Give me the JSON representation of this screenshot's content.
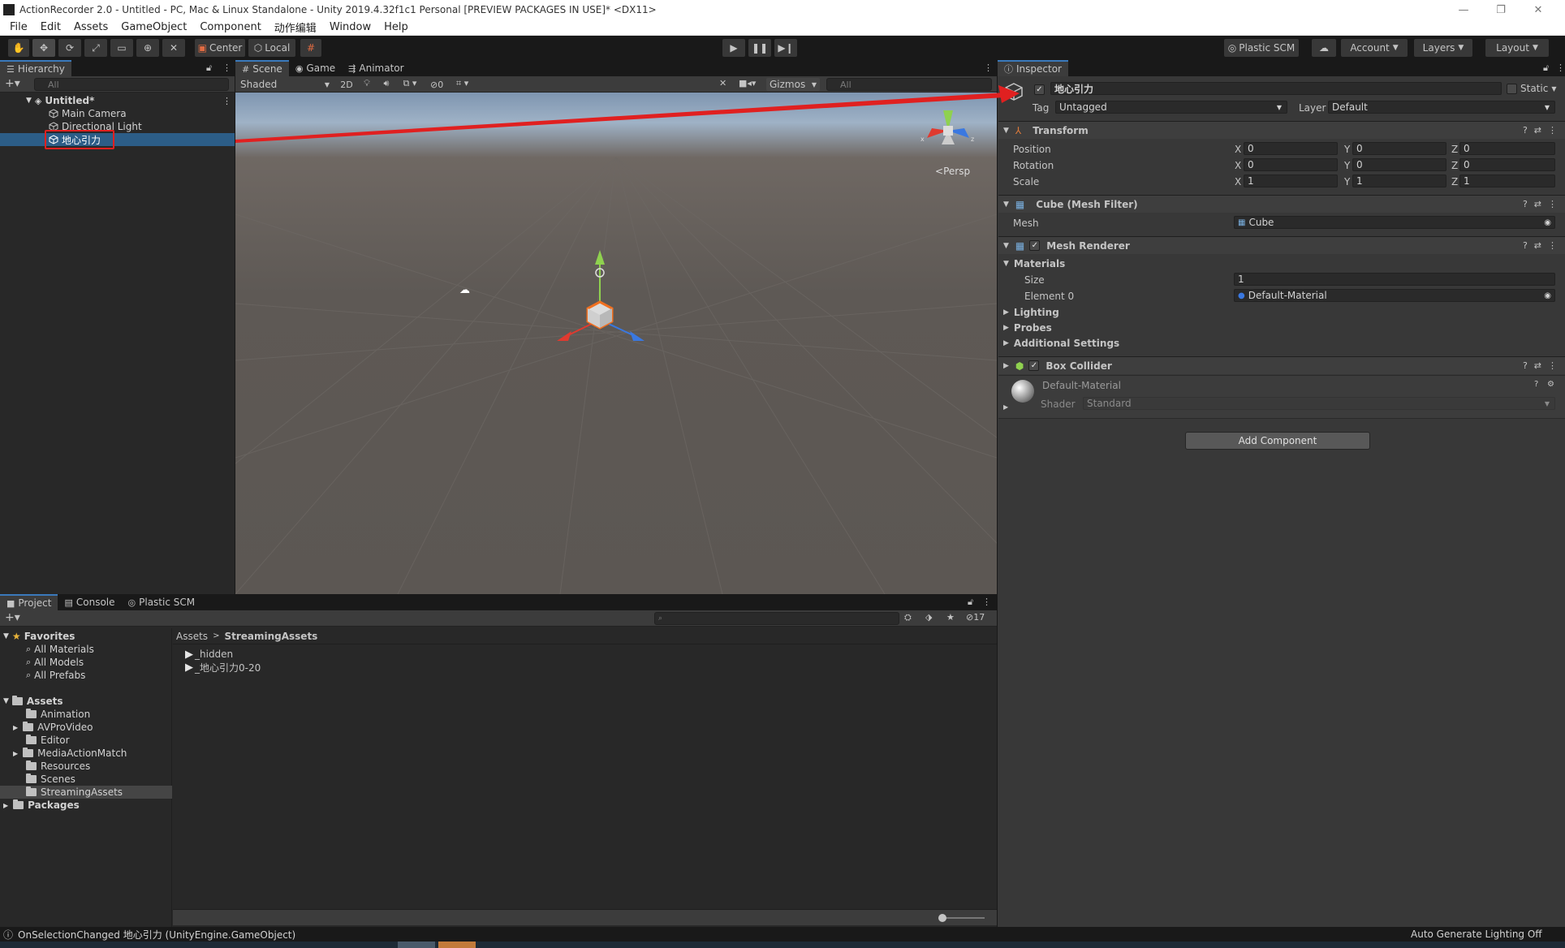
{
  "window": {
    "title": "ActionRecorder 2.0 - Untitled - PC, Mac & Linux Standalone - Unity 2019.4.32f1c1 Personal [PREVIEW PACKAGES IN USE]* <DX11>",
    "minimize": "—",
    "maximize": "❐",
    "close": "✕"
  },
  "menu": [
    "File",
    "Edit",
    "Assets",
    "GameObject",
    "Component",
    "动作编辑",
    "Window",
    "Help"
  ],
  "toolbar": {
    "pivot_label": "Center",
    "space_label": "Local",
    "plastic_label": "Plastic SCM",
    "account_label": "Account",
    "layers_label": "Layers",
    "layout_label": "Layout"
  },
  "hierarchy": {
    "tab_label": "Hierarchy",
    "search_placeholder": "All",
    "scene_name": "Untitled*",
    "items": [
      "Main Camera",
      "Directional Light",
      "地心引力"
    ],
    "selected": "地心引力"
  },
  "scene": {
    "tabs": [
      "Scene",
      "Game",
      "Animator"
    ],
    "draw_mode": "Shaded",
    "mode_2d": "2D",
    "hidden_count": "0",
    "gizmos_label": "Gizmos",
    "search_placeholder": "All",
    "persp_label": "Persp",
    "gizmo_axes": {
      "x_color": "#e03a2f",
      "y_color": "#8fd14f",
      "z_color": "#3a78e0"
    }
  },
  "inspector": {
    "tab_label": "Inspector",
    "object_name": "地心引力",
    "static_label": "Static",
    "tag_label": "Tag",
    "tag_value": "Untagged",
    "layer_label": "Layer",
    "layer_value": "Default",
    "transform": {
      "title": "Transform",
      "position_label": "Position",
      "rotation_label": "Rotation",
      "scale_label": "Scale",
      "position": [
        "0",
        "0",
        "0"
      ],
      "rotation": [
        "0",
        "0",
        "0"
      ],
      "scale": [
        "1",
        "1",
        "1"
      ],
      "axis_labels": [
        "X",
        "Y",
        "Z"
      ]
    },
    "mesh_filter": {
      "title": "Cube (Mesh Filter)",
      "mesh_label": "Mesh",
      "mesh_value": "Cube"
    },
    "mesh_renderer": {
      "title": "Mesh Renderer",
      "materials_label": "Materials",
      "size_label": "Size",
      "size_value": "1",
      "element0_label": "Element 0",
      "element0_value": "Default-Material",
      "lighting_label": "Lighting",
      "probes_label": "Probes",
      "additional_label": "Additional Settings"
    },
    "box_collider": {
      "title": "Box Collider"
    },
    "material": {
      "name": "Default-Material",
      "shader_label": "Shader",
      "shader_value": "Standard"
    },
    "add_component_label": "Add Component"
  },
  "project": {
    "tabs": [
      "Project",
      "Console",
      "Plastic SCM"
    ],
    "badge_count": "17",
    "favorites_label": "Favorites",
    "favorites": [
      "All Materials",
      "All Models",
      "All Prefabs"
    ],
    "assets_label": "Assets",
    "assets_folders": [
      "Animation",
      "AVProVideo",
      "Editor",
      "MediaActionMatch",
      "Resources",
      "Scenes",
      "StreamingAssets"
    ],
    "packages_label": "Packages",
    "breadcrumb": [
      "Assets",
      "StreamingAssets"
    ],
    "files": [
      "_hidden",
      "_地心引力0-20"
    ]
  },
  "status": {
    "message": "OnSelectionChanged 地心引力 (UnityEngine.GameObject)",
    "right_text": "Auto Generate Lighting Off"
  }
}
